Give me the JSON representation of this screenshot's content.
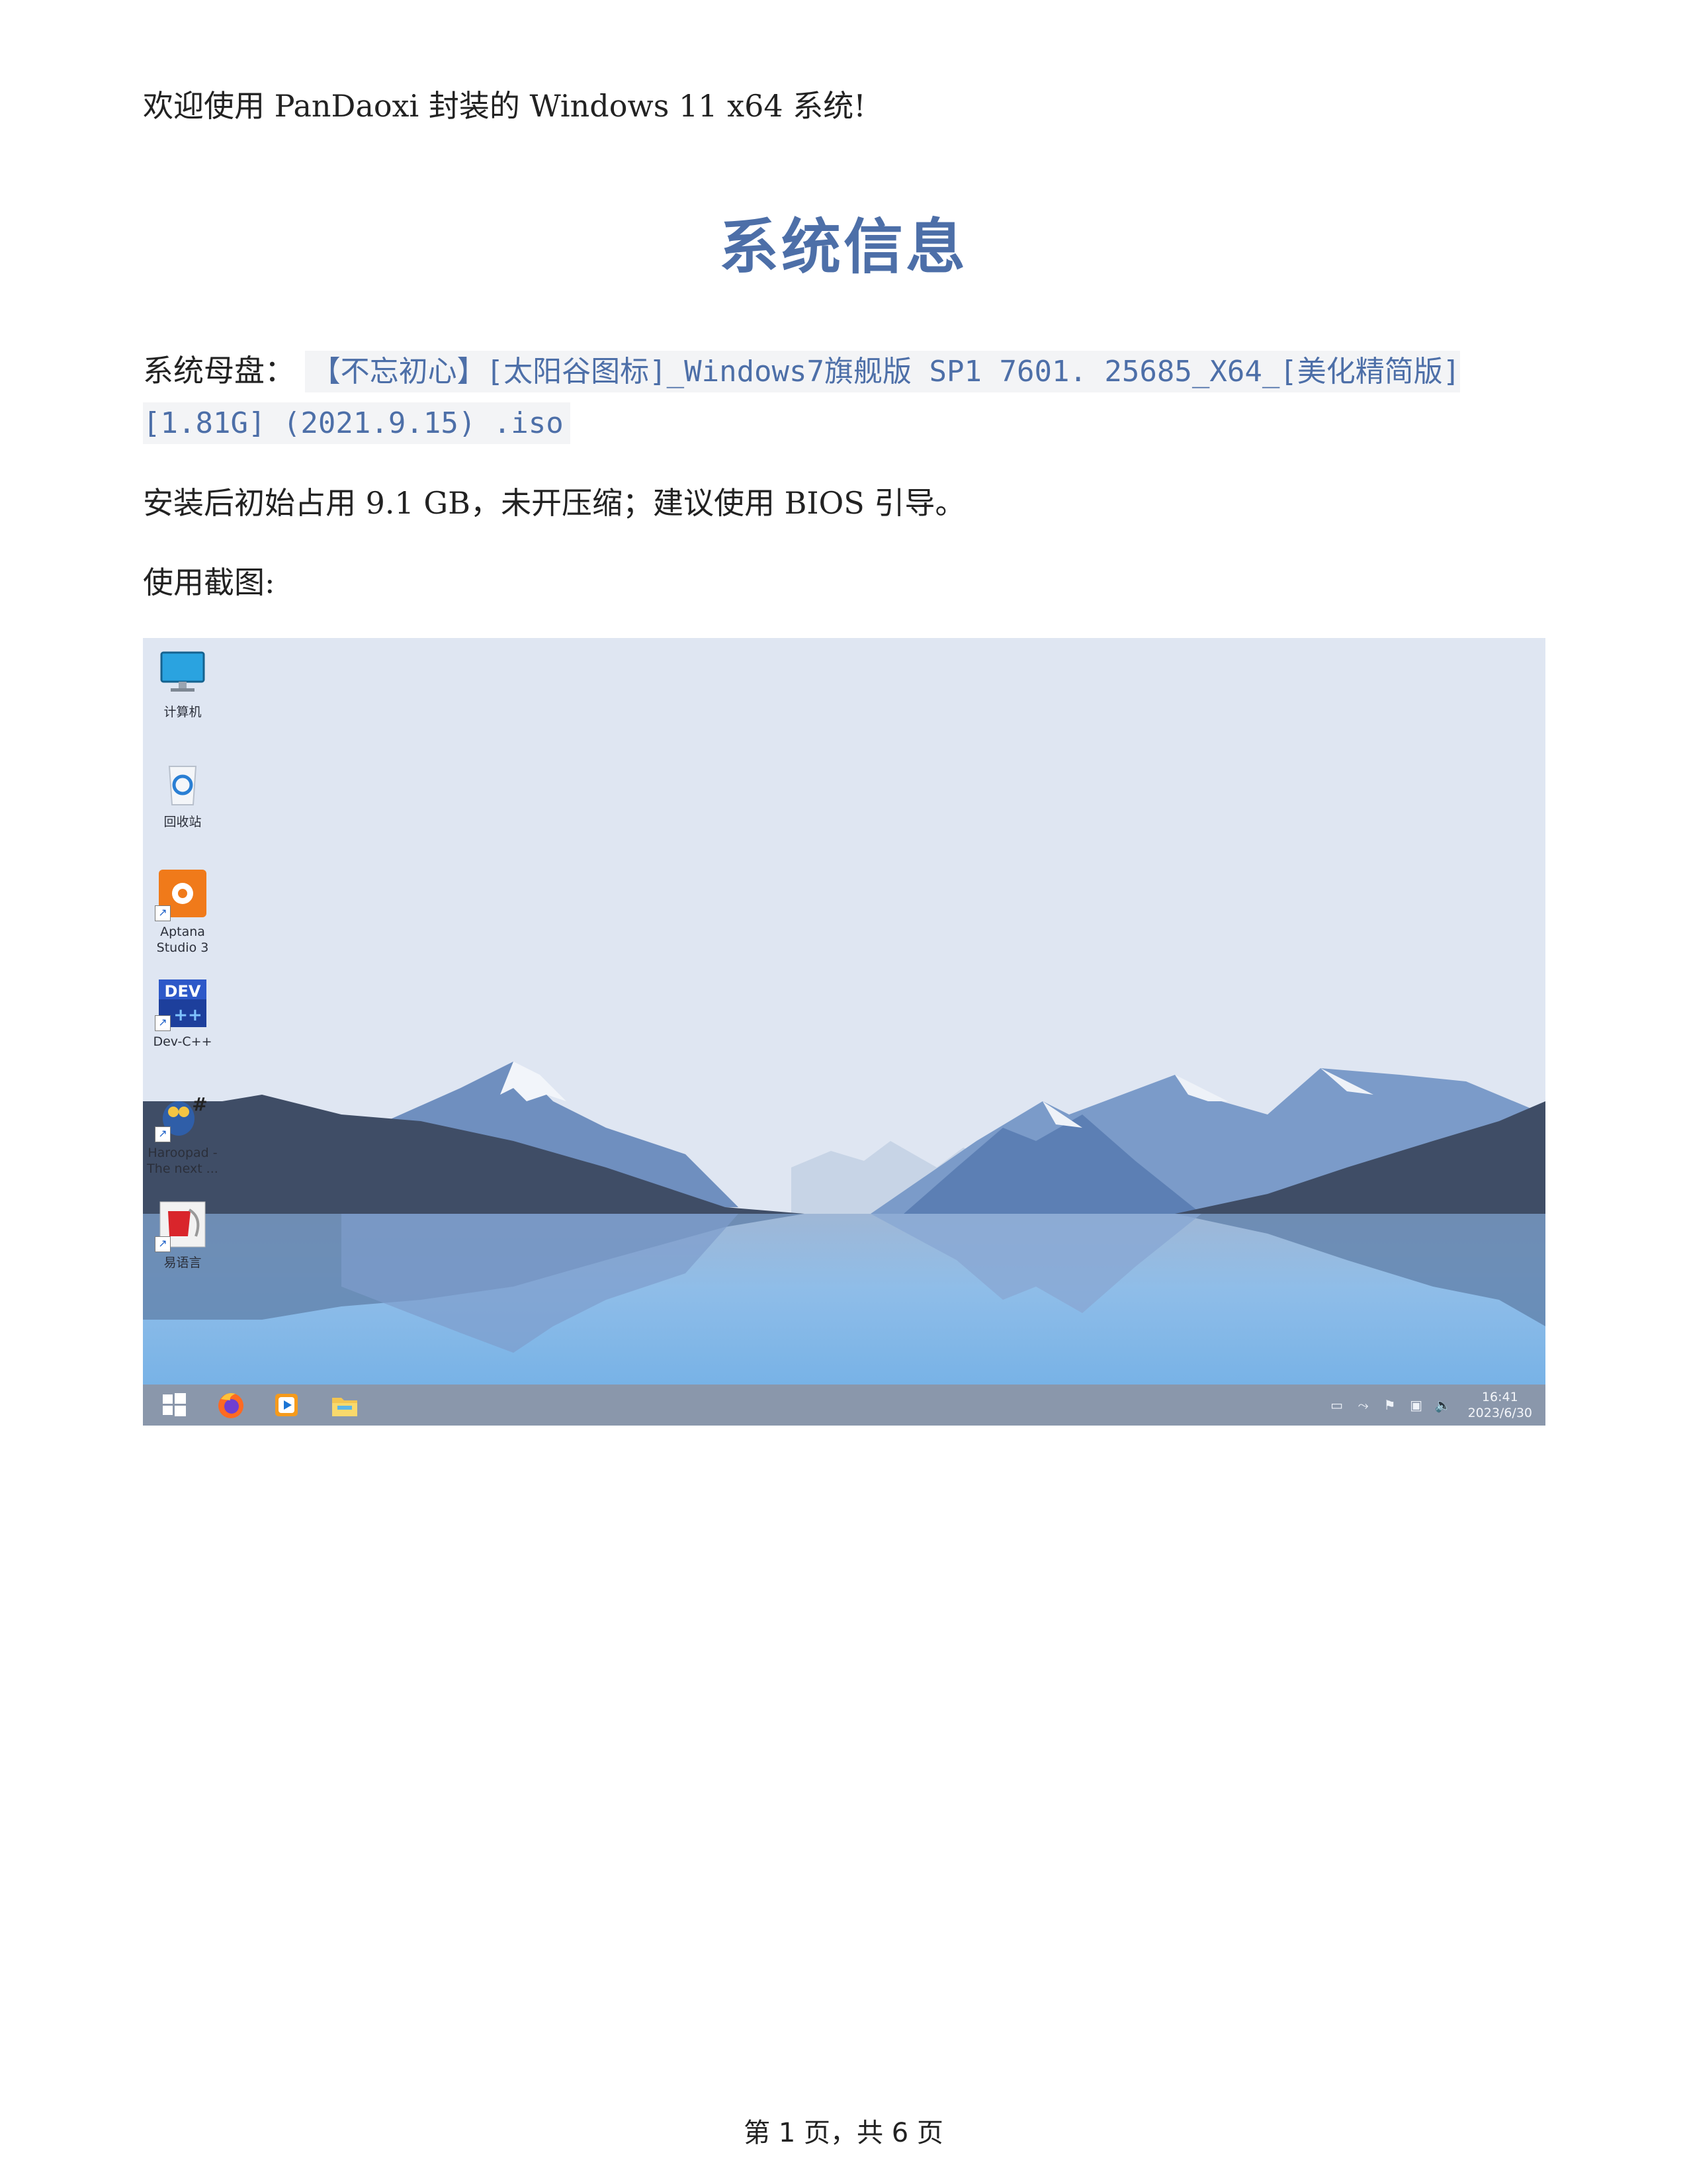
{
  "intro": "欢迎使用 PanDaoxi 封装的 Windows 11 x64 系统!",
  "title": "系统信息",
  "system_image": {
    "label": "系统母盘：",
    "value": "【不忘初心】[太阳谷图标]_Windows7旗舰版 SP1 7601. 25685_X64_[美化精简版] [1.81G] (2021.9.15) .iso"
  },
  "install_note": "安装后初始占用 9.1 GB，未开压缩；建议使用 BIOS 引导。",
  "screenshot_label": "使用截图:",
  "desktop": {
    "icons": [
      {
        "name": "computer-icon",
        "label": "计算机"
      },
      {
        "name": "recycle-bin-icon",
        "label": "回收站"
      },
      {
        "name": "aptana-icon",
        "label": "Aptana Studio 3"
      },
      {
        "name": "dev-cpp-icon",
        "label": "Dev-C++"
      },
      {
        "name": "haroopad-icon",
        "label": "Haroopad - The next ..."
      },
      {
        "name": "eyuyan-icon",
        "label": "易语言"
      }
    ],
    "taskbar": {
      "items": [
        "windows-start-icon",
        "firefox-icon",
        "media-player-icon",
        "file-explorer-icon"
      ],
      "clock_time": "16:41",
      "clock_date": "2023/6/30"
    },
    "colors": {
      "sky": "#dfe6f2",
      "lake": "#7fb6e6",
      "taskbar": "#8a97ab",
      "mountain_dark": "#3f4d66"
    }
  },
  "footer": "第 1 页，共 6 页"
}
